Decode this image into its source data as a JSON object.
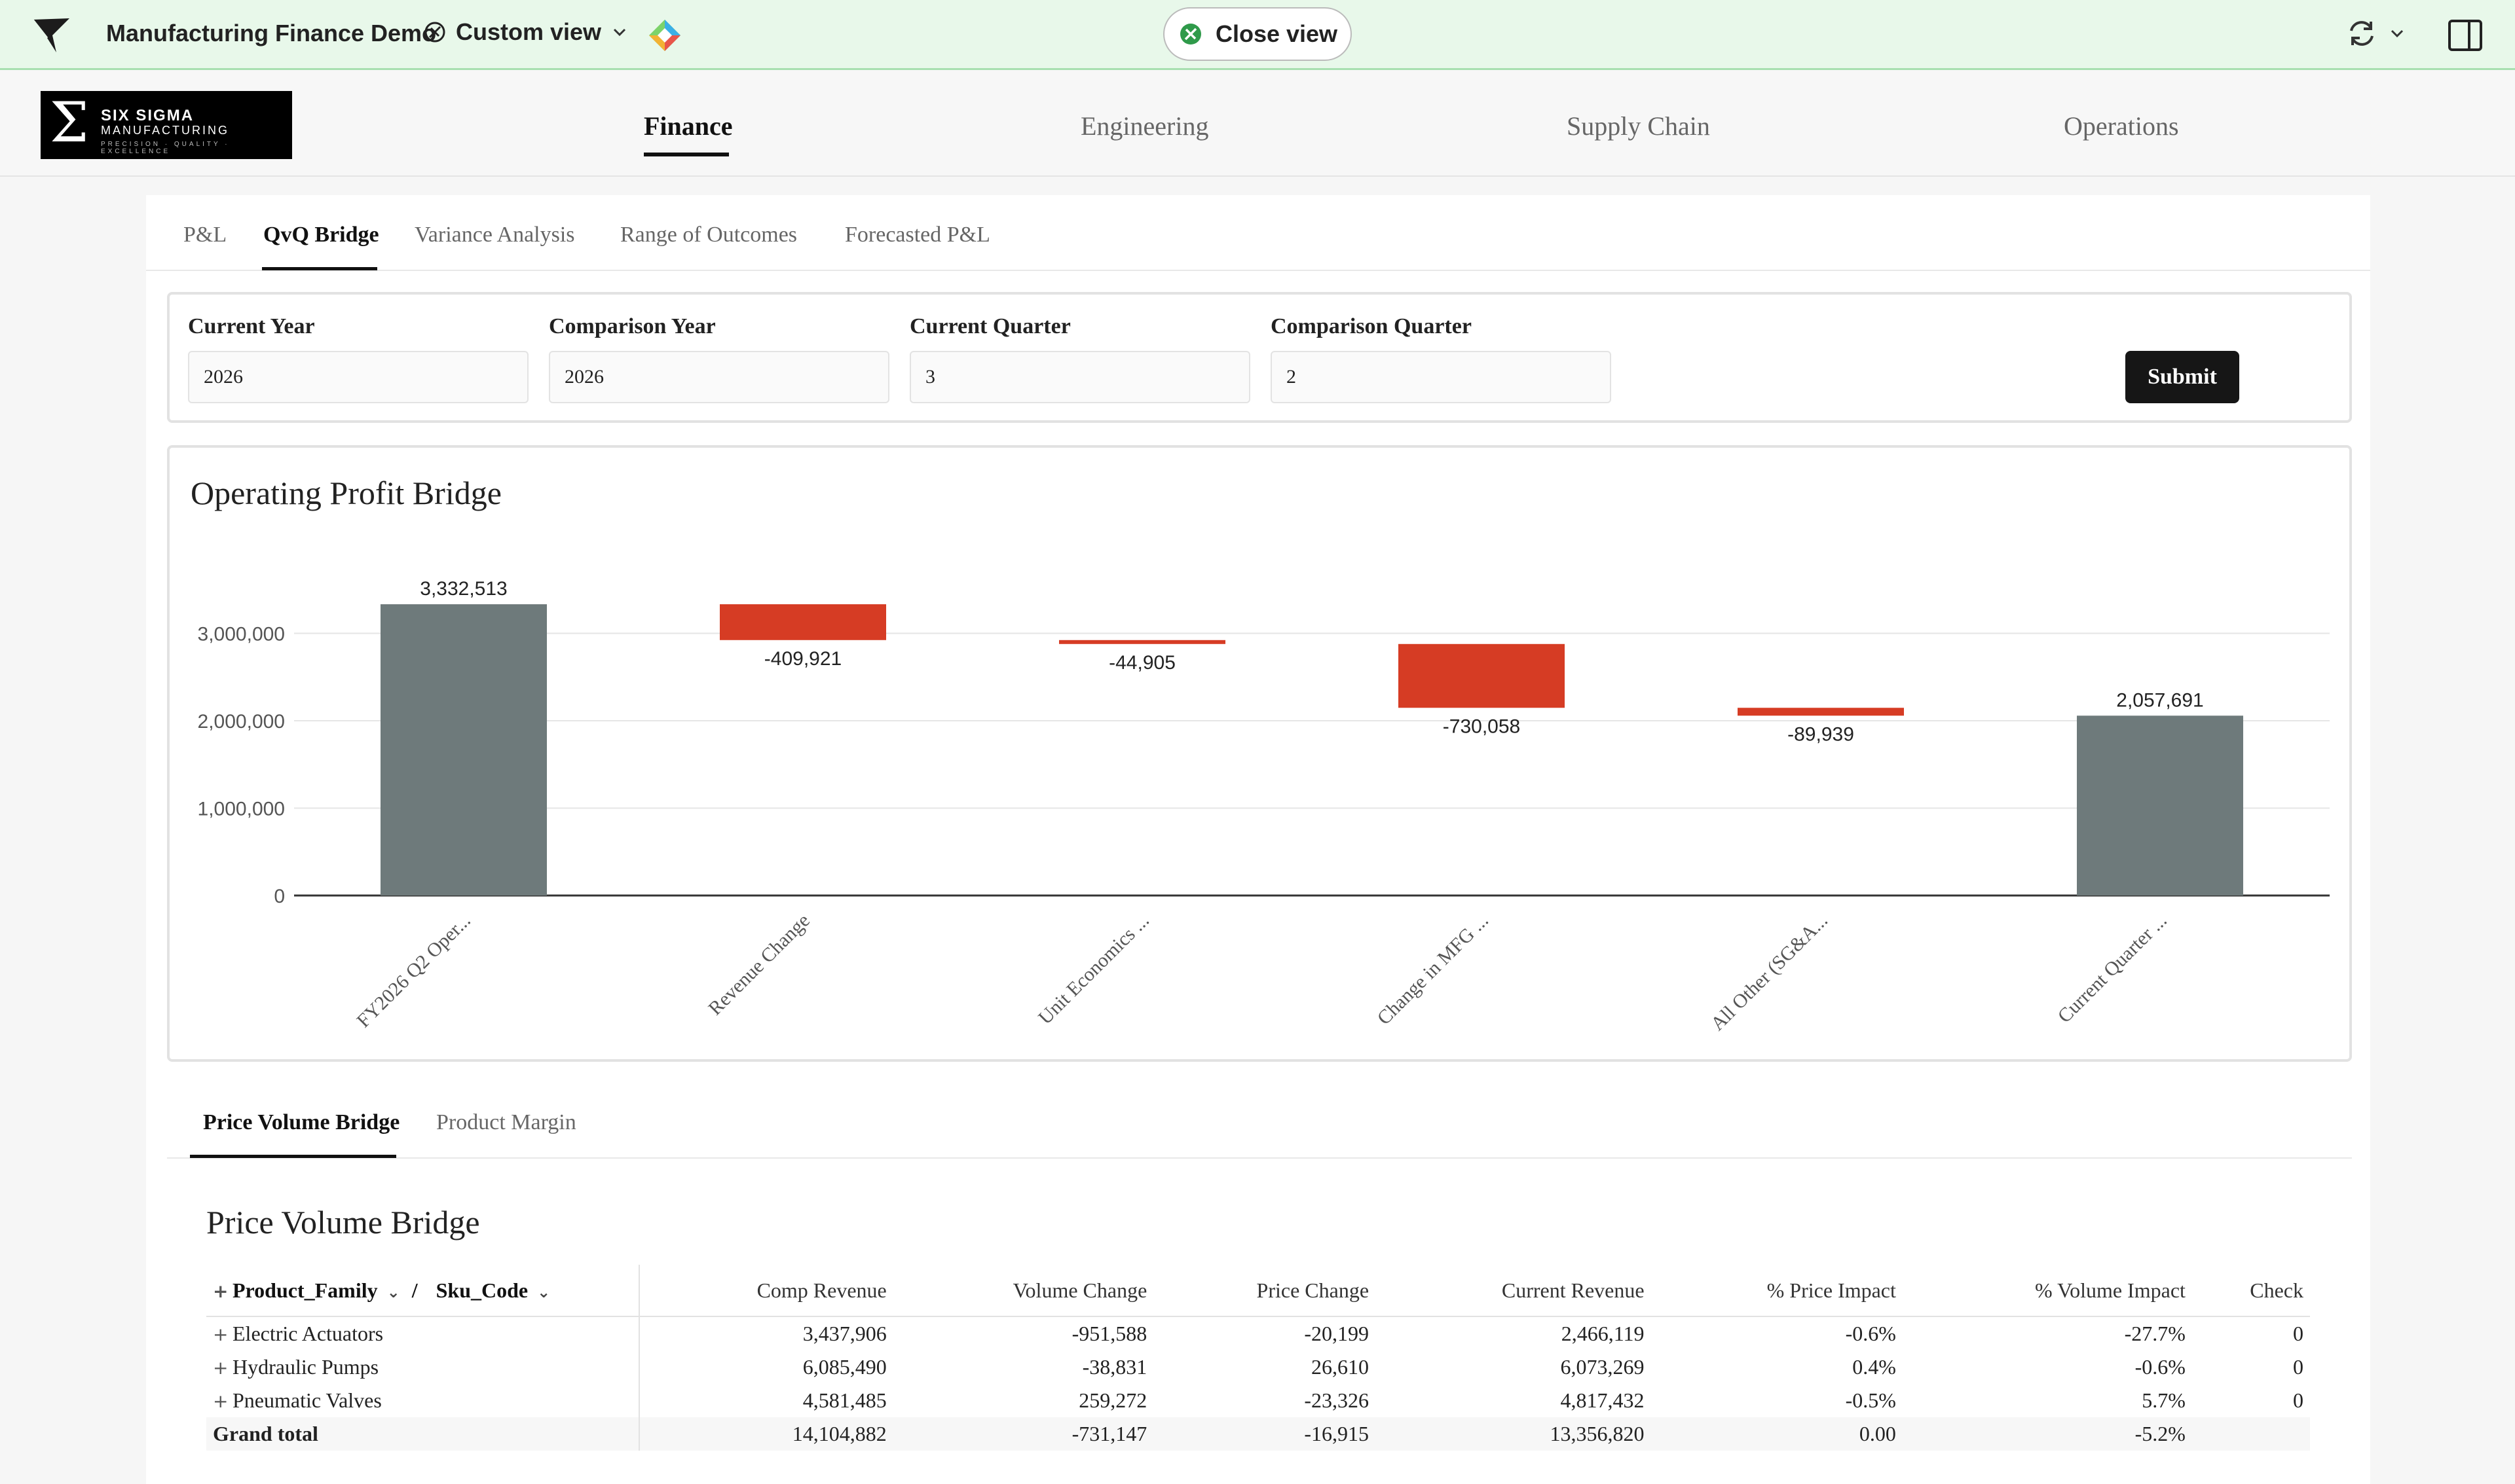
{
  "app": {
    "title": "Manufacturing Finance Demo",
    "view_label": "Custom view",
    "close_view_label": "Close view"
  },
  "brand": {
    "symbol": "Σ",
    "line1": "SIX SIGMA",
    "line2": "MANUFACTURING",
    "line3": "PRECISION · QUALITY · EXCELLENCE"
  },
  "nav": {
    "items": [
      {
        "label": "Finance"
      },
      {
        "label": "Engineering"
      },
      {
        "label": "Supply Chain"
      },
      {
        "label": "Operations"
      }
    ]
  },
  "subtabs": {
    "items": [
      {
        "label": "P&L"
      },
      {
        "label": "QvQ Bridge"
      },
      {
        "label": "Variance Analysis"
      },
      {
        "label": "Range of Outcomes"
      },
      {
        "label": "Forecasted P&L"
      }
    ]
  },
  "filters": {
    "current_year_label": "Current Year",
    "current_year_value": "2026",
    "comparison_year_label": "Comparison Year",
    "comparison_year_value": "2026",
    "current_quarter_label": "Current Quarter",
    "current_quarter_value": "3",
    "comparison_quarter_label": "Comparison Quarter",
    "comparison_quarter_value": "2",
    "submit_label": "Submit"
  },
  "chart_data": {
    "type": "bar",
    "subtype": "waterfall",
    "title": "Operating Profit Bridge",
    "categories": [
      "FY2026 Q2 Oper...",
      "Revenue Change",
      "Unit Economics ...",
      "Change in MFG ...",
      "All Other (SG&A...",
      "Current Quarter ..."
    ],
    "values": [
      3332513,
      -409921,
      -44905,
      -730058,
      -89939,
      2057691
    ],
    "labels": [
      "3,332,513",
      "-409,921",
      "-44,905",
      "-730,058",
      "-89,939",
      "2,057,691"
    ],
    "bar_kinds": [
      "total",
      "delta",
      "delta",
      "delta",
      "delta",
      "total"
    ],
    "yticks": [
      "0",
      "1,000,000",
      "2,000,000",
      "3,000,000"
    ],
    "ylim": [
      0,
      3700000
    ],
    "grid": true,
    "colors": {
      "total": "#6e7a7b",
      "decrease": "#d63c24"
    }
  },
  "bottom_tabs": {
    "items": [
      {
        "label": "Price Volume Bridge"
      },
      {
        "label": "Product Margin"
      }
    ]
  },
  "table": {
    "title": "Price Volume Bridge",
    "group_col_1": "Product_Family",
    "group_sep": "/",
    "group_col_2": "Sku_Code",
    "columns": [
      "Comp Revenue",
      "Volume Change",
      "Price Change",
      "Current Revenue",
      "% Price Impact",
      "% Volume Impact",
      "Check"
    ],
    "rows": [
      {
        "name": "Electric Actuators",
        "cells": [
          "3,437,906",
          "-951,588",
          "-20,199",
          "2,466,119",
          "-0.6%",
          "-27.7%",
          "0"
        ]
      },
      {
        "name": "Hydraulic Pumps",
        "cells": [
          "6,085,490",
          "-38,831",
          "26,610",
          "6,073,269",
          "0.4%",
          "-0.6%",
          "0"
        ]
      },
      {
        "name": "Pneumatic Valves",
        "cells": [
          "4,581,485",
          "259,272",
          "-23,326",
          "4,817,432",
          "-0.5%",
          "5.7%",
          "0"
        ]
      }
    ],
    "grand_total": {
      "name": "Grand total",
      "cells": [
        "14,104,882",
        "-731,147",
        "-16,915",
        "13,356,820",
        "0.00",
        "-5.2%",
        ""
      ]
    }
  }
}
